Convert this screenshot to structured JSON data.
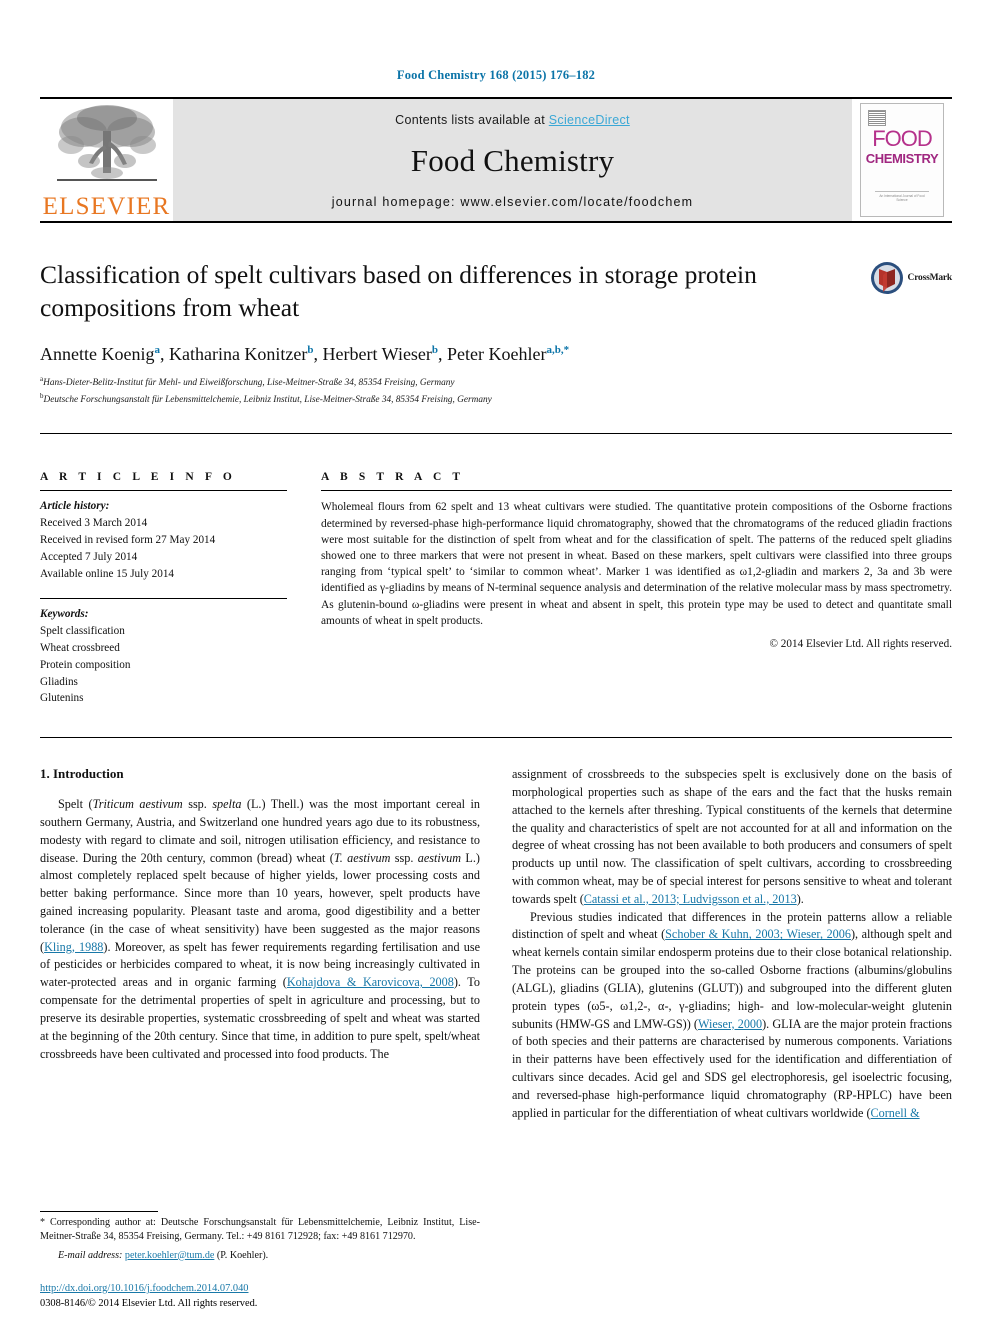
{
  "running_head": "Food Chemistry 168 (2015) 176–182",
  "banner": {
    "publisher_logo_label": "ELSEVIER",
    "contents_prefix": "Contents lists available at ",
    "contents_link": "ScienceDirect",
    "journal_title": "Food Chemistry",
    "homepage_line": "journal homepage: www.elsevier.com/locate/foodchem",
    "cover": {
      "line1": "FOOD",
      "line2": "CHEMISTRY",
      "footer": "An International Journal of Food Science"
    }
  },
  "title_block": {
    "title": "Classification of spelt cultivars based on differences in storage protein compositions from wheat",
    "crossmark_label": "CrossMark",
    "authors": [
      {
        "name": "Annette Koenig",
        "sup": "a",
        "sep": ", "
      },
      {
        "name": "Katharina Konitzer",
        "sup": "b",
        "sep": ", "
      },
      {
        "name": "Herbert Wieser",
        "sup": "b",
        "sep": ", "
      },
      {
        "name": "Peter Koehler",
        "sup": "a,b,",
        "sup_star": "*",
        "sep": ""
      }
    ],
    "affiliations": [
      {
        "sup": "a",
        "text": "Hans-Dieter-Belitz-Institut für Mehl- und Eiweißforschung, Lise-Meitner-Straße 34, 85354 Freising, Germany"
      },
      {
        "sup": "b",
        "text": "Deutsche Forschungsanstalt für Lebensmittelchemie, Leibniz Institut, Lise-Meitner-Straße 34, 85354 Freising, Germany"
      }
    ]
  },
  "article_info": {
    "heading": "A R T I C L E    I N F O",
    "history_label": "Article history:",
    "history": [
      "Received 3 March 2014",
      "Received in revised form 27 May 2014",
      "Accepted 7 July 2014",
      "Available online 15 July 2014"
    ],
    "keywords_label": "Keywords:",
    "keywords": [
      "Spelt classification",
      "Wheat crossbreed",
      "Protein composition",
      "Gliadins",
      "Glutenins"
    ]
  },
  "abstract": {
    "heading": "A B S T R A C T",
    "text": "Wholemeal flours from 62 spelt and 13 wheat cultivars were studied. The quantitative protein compositions of the Osborne fractions determined by reversed-phase high-performance liquid chromatography, showed that the chromatograms of the reduced gliadin fractions were most suitable for the distinction of spelt from wheat and for the classification of spelt. The patterns of the reduced spelt gliadins showed one to three markers that were not present in wheat. Based on these markers, spelt cultivars were classified into three groups ranging from ‘typical spelt’ to ‘similar to common wheat’. Marker 1 was identified as ω1,2-gliadin and markers 2, 3a and 3b were identified as γ-gliadins by means of N-terminal sequence analysis and determination of the relative molecular mass by mass spectrometry. As glutenin-bound ω-gliadins were present in wheat and absent in spelt, this protein type may be used to detect and quantitate small amounts of wheat in spelt products.",
    "copyright": "© 2014 Elsevier Ltd. All rights reserved."
  },
  "body": {
    "section_title": "1. Introduction",
    "left_paragraph_1_a": "Spelt (",
    "left_paragraph_1_italic_1": "Triticum aestivum",
    "left_paragraph_1_b": " ssp. ",
    "left_paragraph_1_italic_2": "spelta",
    "left_paragraph_1_c": " (L.) Thell.) was the most important cereal in southern Germany, Austria, and Switzerland one hundred years ago due to its robustness, modesty with regard to climate and soil, nitrogen utilisation efficiency, and resistance to disease. During the 20th century, common (bread) wheat (",
    "left_paragraph_1_italic_3": "T. aestivum",
    "left_paragraph_1_d": " ssp. ",
    "left_paragraph_1_italic_4": "aestivum",
    "left_paragraph_1_e": " L.) almost completely replaced spelt because of higher yields, lower processing costs and better baking performance. Since more than 10 years, however, spelt products have gained increasing popularity. Pleasant taste and aroma, good digestibility and a better tolerance (in the case of wheat sensitivity) have been suggested as the major reasons (",
    "left_ref_1": "Kling, 1988",
    "left_paragraph_1_f": "). Moreover, as spelt has fewer requirements regarding fertilisation and use of pesticides or herbicides compared to wheat, it is now being increasingly cultivated in water-protected areas and in organic farming (",
    "left_ref_2": "Kohajdova & Karovicova, 2008",
    "left_paragraph_1_g": "). To compensate for the detrimental properties of spelt in agriculture and processing, but to preserve its desirable properties, systematic crossbreeding of spelt and wheat was started at the beginning of the 20th century. Since that time, in addition to pure spelt, spelt/wheat crossbreeds have been cultivated and processed into food products. The",
    "right_paragraph_1_a": "assignment of crossbreeds to the subspecies spelt is exclusively done on the basis of morphological properties such as shape of the ears and the fact that the husks remain attached to the kernels after threshing. Typical constituents of the kernels that determine the quality and characteristics of spelt are not accounted for at all and information on the degree of wheat crossing has not been available to both producers and consumers of spelt products up until now. The classification of spelt cultivars, according to crossbreeding with common wheat, may be of special interest for persons sensitive to wheat and tolerant towards spelt (",
    "right_ref_1": "Catassi et al., 2013; Ludvigsson et al., 2013",
    "right_paragraph_1_b": ").",
    "right_paragraph_2_a": "Previous studies indicated that differences in the protein patterns allow a reliable distinction of spelt and wheat (",
    "right_ref_2": "Schober & Kuhn, 2003; Wieser, 2006",
    "right_paragraph_2_b": "), although spelt and wheat kernels contain similar endosperm proteins due to their close botanical relationship. The proteins can be grouped into the so-called Osborne fractions (albumins/globulins (ALGL), gliadins (GLIA), glutenins (GLUT)) and subgrouped into the different gluten protein types (ω5-, ω1,2-, α-, γ-gliadins; high- and low-molecular-weight glutenin subunits (HMW-GS and LMW-GS)) (",
    "right_ref_3": "Wieser, 2000",
    "right_paragraph_2_c": "). GLIA are the major protein fractions of both species and their patterns are characterised by numerous components. Variations in their patterns have been effectively used for the identification and differentiation of cultivars since decades. Acid gel and SDS gel electrophoresis, gel isoelectric focusing, and reversed-phase high-performance liquid chromatography (RP-HPLC) have been applied in particular for the differentiation of wheat cultivars worldwide (",
    "right_ref_4": "Cornell &"
  },
  "footnote": {
    "star": "*",
    "text": " Corresponding author at: Deutsche Forschungsanstalt für Lebensmittelchemie, Leibniz Institut, Lise-Meitner-Straße 34, 85354 Freising, Germany. Tel.: +49 8161 712928; fax: +49 8161 712970.",
    "email_label": "E-mail address:",
    "email": "peter.koehler@tum.de",
    "email_suffix": " (P. Koehler).",
    "doi": "http://dx.doi.org/10.1016/j.foodchem.2014.07.040",
    "issn_line": "0308-8146/© 2014 Elsevier Ltd. All rights reserved."
  },
  "colors": {
    "link_blue": "#1878a8",
    "header_blue": "#0b74a8",
    "sciencedirect_blue": "#3ba8d6",
    "elsevier_orange": "#e87722",
    "cover_magenta": "#b5318b"
  }
}
